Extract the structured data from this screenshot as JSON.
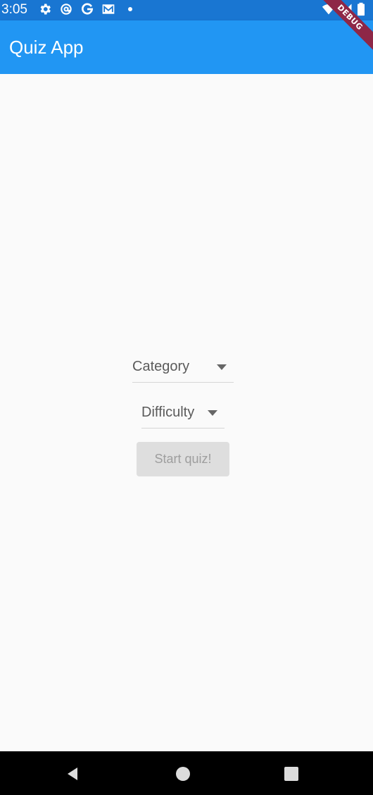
{
  "status_bar": {
    "time": "3:05",
    "left_icons": [
      "gear-icon",
      "at-sign-icon",
      "google-g-icon",
      "gmail-icon",
      "notification-dot-icon"
    ],
    "right_icons": [
      "wifi-icon",
      "signal-icon",
      "battery-icon"
    ]
  },
  "app_bar": {
    "title": "Quiz App"
  },
  "debug_banner": {
    "label": "DEBUG",
    "color": "#8e2747"
  },
  "form": {
    "category": {
      "label": "Category"
    },
    "difficulty": {
      "label": "Difficulty"
    },
    "start_button": {
      "label": "Start quiz!",
      "state": "disabled"
    }
  },
  "nav_bar": {
    "buttons": [
      "back-triangle-icon",
      "home-circle-icon",
      "recents-square-icon"
    ]
  },
  "colors": {
    "status_bar": "#1976d2",
    "app_bar": "#2196f3",
    "background": "#fafafa",
    "button_disabled": "#dedede",
    "nav_bar": "#000000"
  }
}
